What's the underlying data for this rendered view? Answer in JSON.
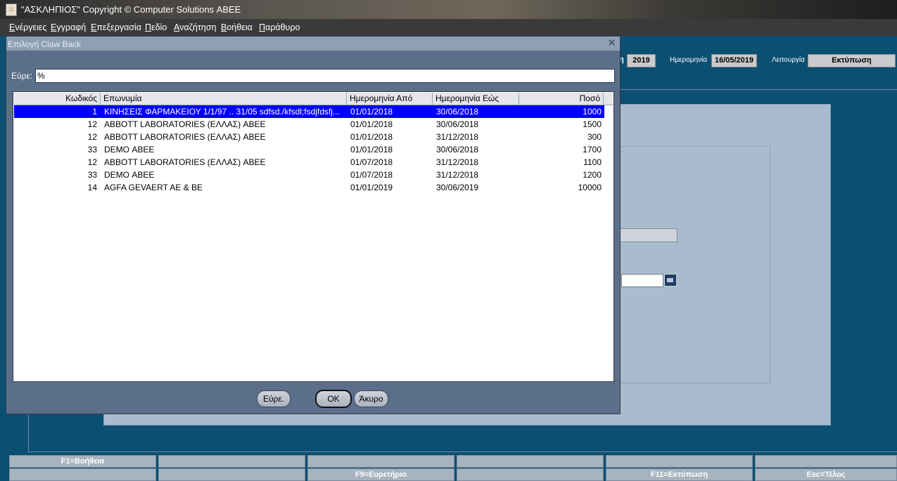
{
  "window": {
    "title": "\"ΑΣΚΛΗΠΙΟΣ\" Copyright © Computer Solutions ΑΒΕΕ",
    "app_icon": "java-cup-icon"
  },
  "menubar": [
    "Ενέργειες",
    "Εγγραφή",
    "Επεξεργασία",
    "Πεδίο",
    "Αναζήτηση",
    "Βοήθεια",
    "Παράθυρο"
  ],
  "header": {
    "year_label_fragment": "η",
    "year": "2019",
    "date_label": "Ημερομηνία",
    "date": "16/05/2019",
    "function_label": "Λειτουργία",
    "function_value": "Εκτύπωση"
  },
  "dialog": {
    "title": "Επιλογή Claw Back",
    "find_label": "Εύρε:",
    "find_value": "%",
    "columns": [
      "Κωδικός",
      "Επωνυμία",
      "Ημερομηνία Από",
      "Ημερομηνία Εώς",
      "Ποσό"
    ],
    "rows": [
      {
        "code": "1",
        "name": "ΚΙΝΗΣΕΙΣ ΦΑΡΜΑΚΕΙΟΥ 1/1/97 .. 31/05 sdfsd./kfsdl;fsdjfdsfj...",
        "from": "01/01/2018",
        "to": "30/06/2018",
        "amount": "1000",
        "selected": true
      },
      {
        "code": "12",
        "name": "ABBOTT LABORATORIES (ΕΛΛΑΣ) ΑΒΕΕ",
        "from": "01/01/2018",
        "to": "30/06/2018",
        "amount": "1500",
        "selected": false
      },
      {
        "code": "12",
        "name": "ABBOTT LABORATORIES (ΕΛΛΑΣ) ΑΒΕΕ",
        "from": "01/01/2018",
        "to": "31/12/2018",
        "amount": "300",
        "selected": false
      },
      {
        "code": "33",
        "name": "DEMO ΑΒΕΕ",
        "from": "01/01/2018",
        "to": "30/06/2018",
        "amount": "1700",
        "selected": false
      },
      {
        "code": "12",
        "name": "ABBOTT LABORATORIES (ΕΛΛΑΣ) ΑΒΕΕ",
        "from": "01/07/2018",
        "to": "31/12/2018",
        "amount": "1100",
        "selected": false
      },
      {
        "code": "33",
        "name": "DEMO ΑΒΕΕ",
        "from": "01/07/2018",
        "to": "31/12/2018",
        "amount": "1200",
        "selected": false
      },
      {
        "code": "14",
        "name": "AGFA GEVAERT AE & BE",
        "from": "01/01/2019",
        "to": "30/06/2019",
        "amount": "10000",
        "selected": false
      }
    ],
    "buttons": {
      "find": "Εύρε.",
      "ok": "OK",
      "cancel": "Άκυρο"
    }
  },
  "function_keys": {
    "row1": [
      "F1=Βοήθεια",
      "",
      "",
      "",
      "",
      ""
    ],
    "row2": [
      "",
      "",
      "F9=Ευρετήριο",
      "",
      "F11=Εκτύπωση",
      "Esc=Τέλος"
    ]
  },
  "colors": {
    "background": "#0b4f72",
    "selection": "#0000ff",
    "dialog": "#5c6f8a"
  }
}
